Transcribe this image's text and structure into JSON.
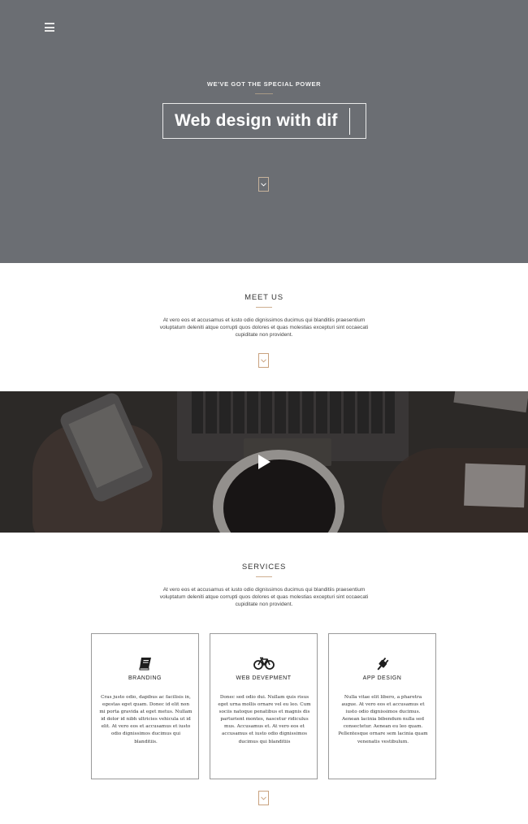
{
  "colors": {
    "hero_bg": "#6b6e73",
    "accent": "#c9a27e",
    "video_bg": "#3a3634"
  },
  "hero": {
    "menu_icon": "hamburger-icon",
    "eyebrow": "WE'VE GOT THE SPECIAL POWER",
    "title": "Web design with dif",
    "scroll_icon": "chevron-down-icon"
  },
  "meet": {
    "title": "MEET US",
    "text": "At vero eos et accusamus et iusto odio dignissimos ducimus qui blanditiis praesentium voluptatum deleniti atque corrupti quos dolores et quas molestias excepturi sint occaecati cupiditate non provident.",
    "scroll_icon": "chevron-down-icon"
  },
  "video": {
    "play_icon": "play-icon"
  },
  "services": {
    "title": "SERVICES",
    "text": "At vero eos et accusamus et iusto odio dignissimos ducimus qui blanditiis praesentium voluptatum deleniti atque corrupti quos dolores et quas molestias excepturi sint occaecati cupiditate non provident.",
    "scroll_icon": "chevron-down-icon",
    "items": [
      {
        "icon": "book-icon",
        "title": "BRANDING",
        "text": "Cras justo odio, dapibus ac facilisis in, egestas eget quam. Donec id elit non mi porta gravida at eget metus. Nullam id dolor id nibh ultricies vehicula ut id elit. At vero eos et accusamus et iusto odio dignissimos ducimus qui blanditiis."
      },
      {
        "icon": "bicycle-icon",
        "title": "WEB DEVEPMENT",
        "text": "Donec sed odio dui. Nullam quis risus eget urna mollis ornare vel eu leo. Cum sociis natoque penatibus et magnis dis parturient montes, nascetur ridiculus mus. Accusamus et. At vero eos et accusamus et iusto odio dignissimos ducimus qui blanditiis"
      },
      {
        "icon": "plug-icon",
        "title": "APP DESIGN",
        "text": "Nulla vitae elit libero, a pharetra augue. At vero eos et accusamus et iusto odio dignissimos ducimus. Aenean lacinia bibendum nulla sed consectetur. Aenean eu leo quam. Pellentesque ornare sem lacinia quam venenatis vestibulum."
      }
    ]
  }
}
